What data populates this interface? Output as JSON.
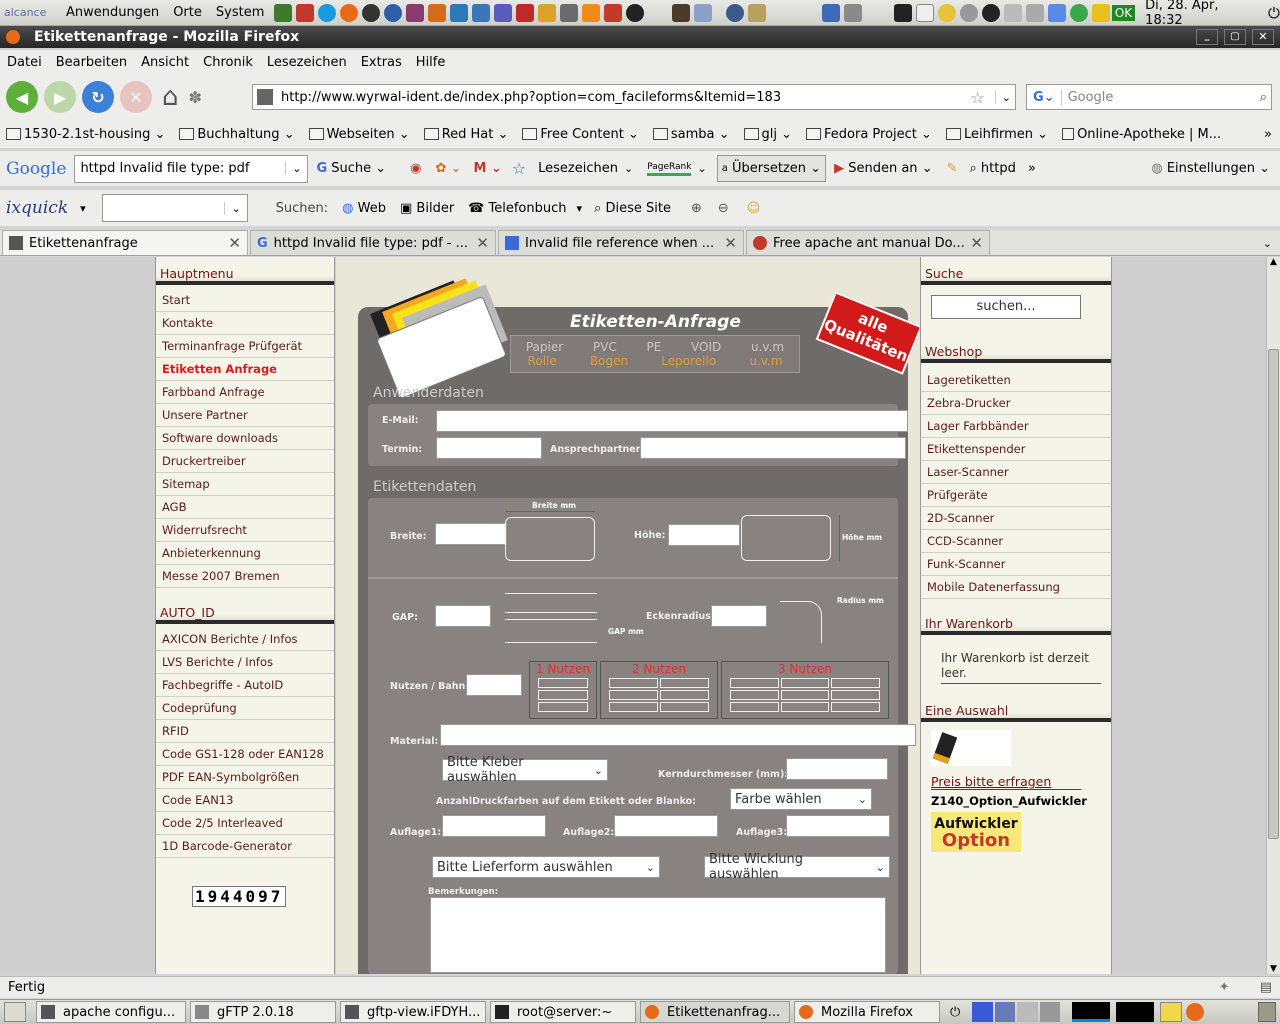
{
  "panel": {
    "menus": [
      "Anwendungen",
      "Orte",
      "System"
    ],
    "clock": "Di, 28. Apr, 18:32",
    "ok_badge": "OK"
  },
  "window": {
    "title": "Etikettenanfrage - Mozilla Firefox"
  },
  "menubar": [
    "Datei",
    "Bearbeiten",
    "Ansicht",
    "Chronik",
    "Lesezeichen",
    "Extras",
    "Hilfe"
  ],
  "urlbar": {
    "url": "http://www.wyrwal-ident.de/index.php?option=com_facileforms&Itemid=183"
  },
  "search": {
    "placeholder": "Google"
  },
  "bookmarks": [
    "1530-2.1st-housing",
    "Buchhaltung",
    "Webseiten",
    "Red Hat",
    "Free Content",
    "samba",
    "glj",
    "Fedora Project",
    "Leihfirmen",
    "Online-Apotheke | M..."
  ],
  "google_toolbar": {
    "query": "httpd Invalid file type: pdf",
    "search": "Suche",
    "lesezeichen": "Lesezeichen",
    "pagerank": "PageRank",
    "translate": "Übersetzen",
    "send": "Senden an",
    "httpd": "httpd",
    "settings": "Einstellungen"
  },
  "ixquick": {
    "logo": "ixquick",
    "label": "Suchen:",
    "web": "Web",
    "images": "Bilder",
    "phone": "Telefonbuch",
    "site": "Diese Site"
  },
  "tabs": [
    {
      "label": "Etikettenanfrage"
    },
    {
      "label": "httpd Invalid file type: pdf - ..."
    },
    {
      "label": "Invalid file reference when ..."
    },
    {
      "label": "Free apache ant manual Do..."
    }
  ],
  "left": {
    "hauptmenu_title": "Hauptmenu",
    "hauptmenu": [
      "Start",
      "Kontakte",
      "Terminanfrage Prüfgerät",
      "Etiketten Anfrage",
      "Farbband Anfrage",
      "Unsere Partner",
      "Software downloads",
      "Druckertreiber",
      "Sitemap",
      "AGB",
      "Widerrufsrecht",
      "Anbieterkennung",
      "Messe 2007 Bremen"
    ],
    "active_index": 3,
    "autoid_title": "AUTO_ID",
    "autoid": [
      "AXICON Berichte / Infos",
      "LVS Berichte / Infos",
      "Fachbegriffe - AutoID",
      "Codeprüfung",
      "RFID",
      "Code GS1-128 oder EAN128",
      "PDF EAN-Symbolgrößen",
      "Code EAN13",
      "Code 2/5 Interleaved",
      "1D Barcode-Generator"
    ],
    "counter": "1944097"
  },
  "form": {
    "title": "Etiketten-Anfrage",
    "types_top": [
      "Papier",
      "PVC",
      "PE",
      "VOID",
      "u.v.m"
    ],
    "types_bottom": [
      "Rolle",
      "Bogen",
      "Leporello",
      "",
      "u.v.m"
    ],
    "badge_line1": "alle",
    "badge_line2": "Qualitäten",
    "sec_anwender": "Anwenderdaten",
    "email": "E-Mail:",
    "termin": "Termin:",
    "ansprech": "Ansprechpartner:",
    "sec_etiketten": "Etikettendaten",
    "breite": "Breite:",
    "breite_mm": "Breite mm",
    "hoehe": "Höhe:",
    "hoehe_mm": "Höhe mm",
    "gap": "GAP:",
    "gap_mm": "GAP mm",
    "eckenradius": "Eckenradius:",
    "radius_mm": "Radius mm",
    "nutzen_bahn": "Nutzen / Bahn:",
    "n1": "1 Nutzen",
    "n2": "2 Nutzen",
    "n3": "3 Nutzen",
    "material": "Material:",
    "kleber": "Bitte Kleber auswählen",
    "kern": "Kerndurchmesser (mm):",
    "farben": "AnzahlDruckfarben auf dem Etikett oder Blanko:",
    "farbe_sel": "Farbe wählen",
    "auflage1": "Auflage1:",
    "auflage2": "Auflage2:",
    "auflage3": "Auflage3:",
    "lieferform": "Bitte Lieferform auswählen",
    "wicklung": "Bitte Wicklung auswählen",
    "bemerkungen": "Bemerkungen:"
  },
  "right": {
    "suche_title": "Suche",
    "suche_placeholder": "suchen...",
    "webshop_title": "Webshop",
    "webshop": [
      "Lageretiketten",
      "Zebra-Drucker",
      "Lager Farbbänder",
      "Etikettenspender",
      "Laser-Scanner",
      "Prüfgeräte",
      "2D-Scanner",
      "CCD-Scanner",
      "Funk-Scanner",
      "Mobile Datenerfassung"
    ],
    "cart_title": "Ihr Warenkorb",
    "cart_text": "Ihr Warenkorb ist derzeit leer.",
    "auswahl_title": "Eine Auswahl",
    "price": "Preis bitte erfragen",
    "product": "Z140_Option_Aufwickler",
    "product_img_text": "Aufwickler",
    "product_img_text2": "Option"
  },
  "status": "Fertig",
  "taskbar": [
    "apache configu...",
    "gFTP 2.0.18",
    "gftp-view.iFDYH...",
    "root@server:~",
    "Etikettenanfrag...",
    "Mozilla Firefox"
  ]
}
